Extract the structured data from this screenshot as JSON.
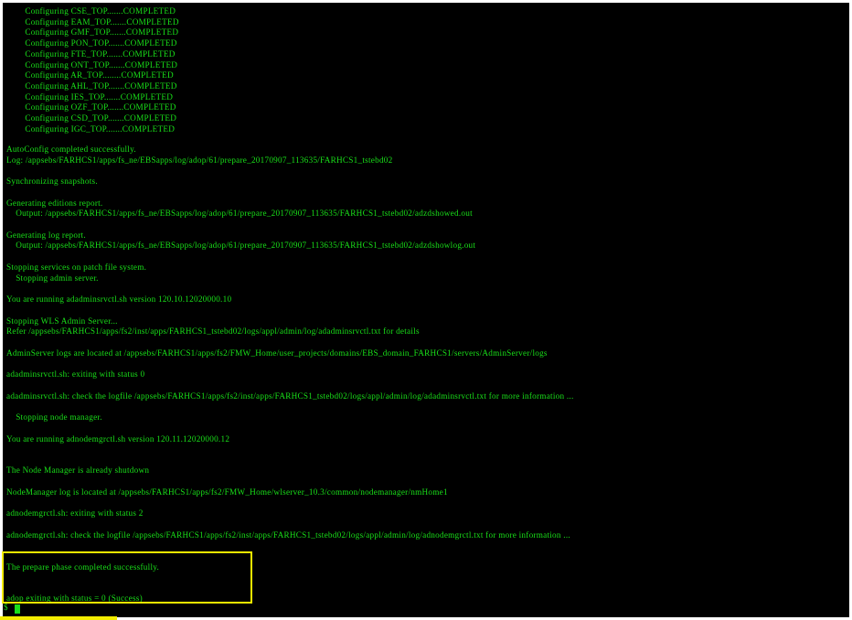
{
  "terminal": {
    "text_color": "#19e019",
    "background": "#000000",
    "highlight_color": "#f2ec00",
    "lines": [
      "        Configuring CSE_TOP.......COMPLETED",
      "        Configuring EAM_TOP.......COMPLETED",
      "        Configuring GMF_TOP.......COMPLETED",
      "        Configuring PON_TOP.......COMPLETED",
      "        Configuring FTE_TOP.......COMPLETED",
      "        Configuring ONT_TOP.......COMPLETED",
      "        Configuring AR_TOP........COMPLETED",
      "        Configuring AHL_TOP.......COMPLETED",
      "        Configuring IES_TOP.......COMPLETED",
      "        Configuring OZF_TOP.......COMPLETED",
      "        Configuring CSD_TOP.......COMPLETED",
      "        Configuring IGC_TOP.......COMPLETED",
      "AutoConfig completed successfully.",
      "Log: /appsebs/FARHCS1/apps/fs_ne/EBSapps/log/adop/61/prepare_20170907_113635/FARHCS1_tstebd02",
      "Synchronizing snapshots.",
      "Generating editions report.",
      "    Output: /appsebs/FARHCS1/apps/fs_ne/EBSapps/log/adop/61/prepare_20170907_113635/FARHCS1_tstebd02/adzdshowed.out",
      "Generating log report.",
      "    Output: /appsebs/FARHCS1/apps/fs_ne/EBSapps/log/adop/61/prepare_20170907_113635/FARHCS1_tstebd02/adzdshowlog.out",
      "Stopping services on patch file system.",
      "    Stopping admin server.",
      "You are running adadminsrvctl.sh version 120.10.12020000.10",
      "Stopping WLS Admin Server...",
      "Refer /appsebs/FARHCS1/apps/fs2/inst/apps/FARHCS1_tstebd02/logs/appl/admin/log/adadminsrvctl.txt for details",
      "AdminServer logs are located at /appsebs/FARHCS1/apps/fs2/FMW_Home/user_projects/domains/EBS_domain_FARHCS1/servers/AdminServer/logs",
      "adadminsrvctl.sh: exiting with status 0",
      "adadminsrvctl.sh: check the logfile /appsebs/FARHCS1/apps/fs2/inst/apps/FARHCS1_tstebd02/logs/appl/admin/log/adadminsrvctl.txt for more information ...",
      "    Stopping node manager.",
      "You are running adnodemgrctl.sh version 120.11.12020000.12",
      "The Node Manager is already shutdown",
      "NodeManager log is located at /appsebs/FARHCS1/apps/fs2/FMW_Home/wlserver_10.3/common/nodemanager/nmHome1",
      "adnodemgrctl.sh: exiting with status 2",
      "adnodemgrctl.sh: check the logfile /appsebs/FARHCS1/apps/fs2/inst/apps/FARHCS1_tstebd02/logs/appl/admin/log/adnodemgrctl.txt for more information ...",
      "The prepare phase completed successfully.",
      "adop exiting with status = 0 (Success)"
    ],
    "prompt": "$"
  }
}
